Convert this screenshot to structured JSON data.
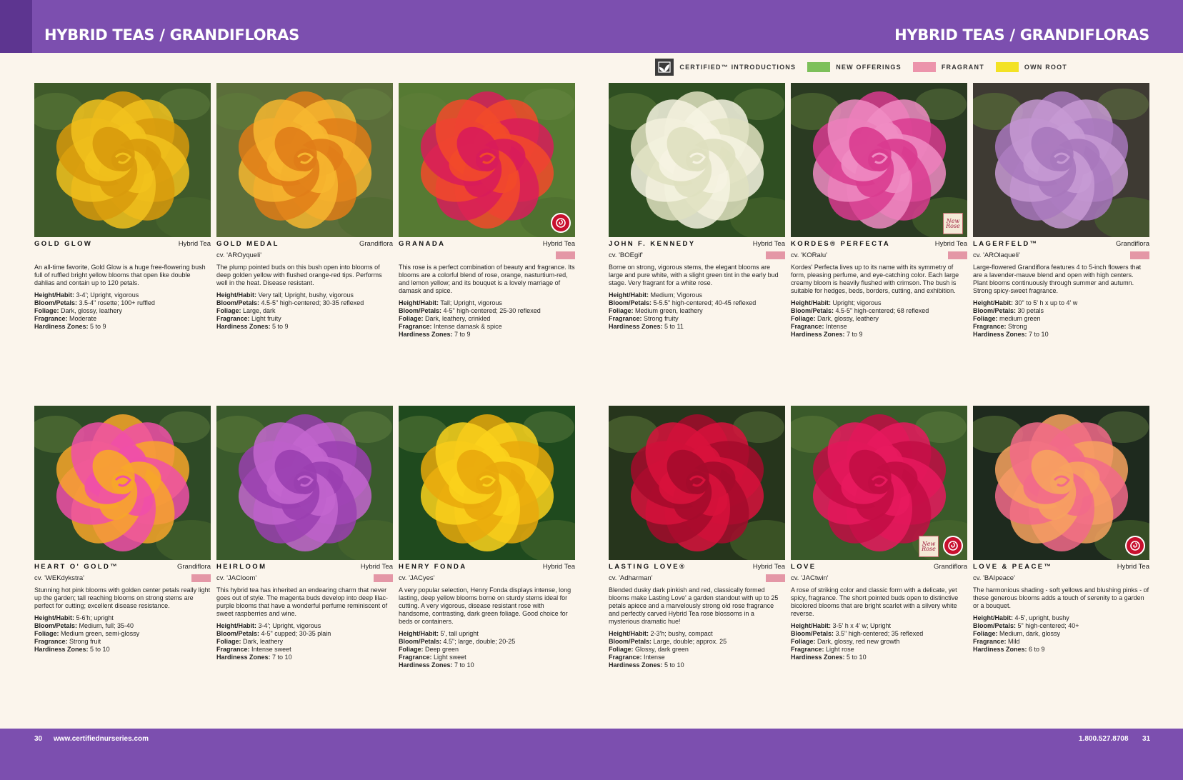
{
  "header": {
    "left_title": "HYBRID TEAS / GRANDIFLORAS",
    "right_title": "HYBRID TEAS / GRANDIFLORAS"
  },
  "legend": [
    {
      "label": "CERTIFIED™ INTRODUCTIONS",
      "icon": "certified-leaf-icon"
    },
    {
      "label": "NEW OFFERINGS",
      "color": "#7dc05a"
    },
    {
      "label": "FRAGRANT",
      "color": "#ec94ab"
    },
    {
      "label": "OWN ROOT",
      "color": "#f3e224"
    }
  ],
  "colors": {
    "brand_purple": "#7c4faf",
    "fragrant_pink": "#e497a6",
    "page_background": "#fbf5ec"
  },
  "roses": [
    {
      "name": "GOLD GLOW",
      "class": "Hybrid Tea",
      "cv": "",
      "fragrant": false,
      "badges": [],
      "photo_color": "#f2c21d",
      "photo_dark": "#d89a0c",
      "photo_bg": "#3f5a2a",
      "description": "An all-time favorite, Gold Glow is a huge free-flowering bush full of ruffled bright yellow blooms that open like double dahlias and contain up to 120 petals.",
      "specs": [
        {
          "label": "Height/Habit:",
          "value": "3-4'; Upright, vigorous"
        },
        {
          "label": "Bloom/Petals:",
          "value": "3.5-4\" rosette; 100+ ruffled"
        },
        {
          "label": "Foliage:",
          "value": "Dark, glossy, leathery"
        },
        {
          "label": "Fragrance:",
          "value": "Moderate"
        },
        {
          "label": "Hardiness Zones:",
          "value": "5 to 9"
        }
      ]
    },
    {
      "name": "GOLD MEDAL",
      "class": "Grandiflora",
      "cv": "cv. 'AROyqueli'",
      "fragrant": false,
      "badges": [],
      "photo_color": "#f7b730",
      "photo_dark": "#e07d18",
      "photo_bg": "#5b6e3a",
      "description": "The plump pointed buds on this bush open into blooms of deep golden yellow with flushed orange-red tips. Performs well in the heat. Disease resistant.",
      "specs": [
        {
          "label": "Height/Habit:",
          "value": "Very tall; Upright, bushy, vigorous"
        },
        {
          "label": "Bloom/Petals:",
          "value": "4.5-5\" high-centered; 30-35 reflexed"
        },
        {
          "label": "Foliage:",
          "value": "Large, dark"
        },
        {
          "label": "Fragrance:",
          "value": "Light fruity"
        },
        {
          "label": "Hardiness Zones:",
          "value": "5 to 9"
        }
      ]
    },
    {
      "name": "GRANADA",
      "class": "Hybrid Tea",
      "cv": "",
      "fragrant": true,
      "badges": [
        "rose"
      ],
      "photo_color": "#f24a2a",
      "photo_dark": "#d81c5a",
      "photo_bg": "#567a33",
      "description": "This rose is a perfect combination of beauty and fragrance. Its blooms are a colorful blend of rose, orange, nasturtium-red, and lemon yellow; and its bouquet is a lovely marriage of damask and spice.",
      "specs": [
        {
          "label": "Height/Habit:",
          "value": "Tall; Upright, vigorous"
        },
        {
          "label": "Bloom/Petals:",
          "value": "4-5\" high-centered; 25-30 reflexed"
        },
        {
          "label": "Foliage:",
          "value": "Dark, leathery, crinkled"
        },
        {
          "label": "Fragrance:",
          "value": "Intense damask & spice"
        },
        {
          "label": "Hardiness Zones:",
          "value": "7 to 9"
        }
      ]
    },
    {
      "name": "JOHN F. KENNEDY",
      "class": "Hybrid Tea",
      "cv": "cv. 'BOEgif'",
      "fragrant": true,
      "badges": [],
      "photo_color": "#f6f3e2",
      "photo_dark": "#dfe0c0",
      "photo_bg": "#2f4f22",
      "description": "Borne on strong, vigorous stems, the elegant blooms are large and pure white, with a slight green tint in the early bud stage. Very fragrant for a white rose.",
      "specs": [
        {
          "label": "Height/Habit:",
          "value": "Medium; Vigorous"
        },
        {
          "label": "Bloom/Petals:",
          "value": "5-5.5\" high-centered; 40-45 reflexed"
        },
        {
          "label": "Foliage:",
          "value": "Medium green, leathery"
        },
        {
          "label": "Fragrance:",
          "value": "Strong fruity"
        },
        {
          "label": "Hardiness Zones:",
          "value": "5 to 11"
        }
      ]
    },
    {
      "name": "KORDES® PERFECTA",
      "class": "Hybrid Tea",
      "cv": "cv. 'KORalu'",
      "fragrant": true,
      "badges": [
        "new"
      ],
      "photo_color": "#f08cc3",
      "photo_dark": "#d93b8f",
      "photo_bg": "#2a3a22",
      "description": "Kordes' Perfecta lives up to its name with its symmetry of form, pleasing perfume, and eye-catching color. Each large creamy bloom is heavily flushed with crimson. The bush is suitable for hedges, beds, borders, cutting, and exhibition.",
      "specs": [
        {
          "label": "Height/Habit:",
          "value": "Upright; vigorous"
        },
        {
          "label": "Bloom/Petals:",
          "value": "4.5-5\" high-centered; 68 reflexed"
        },
        {
          "label": "Foliage:",
          "value": "Dark, glossy, leathery"
        },
        {
          "label": "Fragrance:",
          "value": "Intense"
        },
        {
          "label": "Hardiness Zones:",
          "value": "7 to 9"
        }
      ]
    },
    {
      "name": "LAGERFELD™",
      "class": "Grandiflora",
      "cv": "cv. 'AROlaqueli'",
      "fragrant": true,
      "badges": [],
      "photo_color": "#c79ad4",
      "photo_dark": "#a878bd",
      "photo_bg": "#3e3a33",
      "description": "Large-flowered Grandiflora features 4 to 5-inch flowers that are a lavender-mauve blend and open with high centers. Plant blooms continuously through summer and autumn. Strong spicy-sweet fragrance.",
      "specs": [
        {
          "label": "Height/Habit:",
          "value": "30\" to 5' h x up to 4' w"
        },
        {
          "label": "Bloom/Petals:",
          "value": "30 petals"
        },
        {
          "label": "Foliage:",
          "value": "medium green"
        },
        {
          "label": "Fragrance:",
          "value": "Strong"
        },
        {
          "label": "Hardiness Zones:",
          "value": "7 to 10"
        }
      ]
    },
    {
      "name": "HEART O' GOLD™",
      "class": "Grandiflora",
      "cv": "cv. 'WEKdykstra'",
      "fragrant": true,
      "badges": [],
      "photo_color": "#f04fa8",
      "photo_dark": "#f7a62a",
      "photo_bg": "#2e4a26",
      "description": "Stunning hot pink blooms with golden center petals really light up the garden; tall reaching blooms on strong stems are perfect for cutting; excellent disease resistance.",
      "specs": [
        {
          "label": "Height/Habit:",
          "value": "5-6'h; upright"
        },
        {
          "label": "Bloom/Petals:",
          "value": "Medium, full; 35-40"
        },
        {
          "label": "Foliage:",
          "value": "Medium green, semi-glossy"
        },
        {
          "label": "Fragrance:",
          "value": "Strong fruit"
        },
        {
          "label": "Hardiness Zones:",
          "value": "5 to 10"
        }
      ]
    },
    {
      "name": "HEIRLOOM",
      "class": "Hybrid Tea",
      "cv": "cv. 'JACloom'",
      "fragrant": true,
      "badges": [],
      "photo_color": "#c366cf",
      "photo_dark": "#9a3fb0",
      "photo_bg": "#3a5a2c",
      "description": "This hybrid tea has inherited an endearing charm that never goes out of style. The magenta buds develop into deep lilac-purple blooms that have a wonderful perfume reminiscent of sweet raspberries and wine.",
      "specs": [
        {
          "label": "Height/Habit:",
          "value": "3-4'; Upright, vigorous"
        },
        {
          "label": "Bloom/Petals:",
          "value": "4-5\" cupped; 30-35 plain"
        },
        {
          "label": "Foliage:",
          "value": "Dark, leathery"
        },
        {
          "label": "Fragrance:",
          "value": "Intense sweet"
        },
        {
          "label": "Hardiness Zones:",
          "value": "7 to 10"
        }
      ]
    },
    {
      "name": "HENRY FONDA",
      "class": "Hybrid Tea",
      "cv": "cv. 'JACyes'",
      "fragrant": false,
      "badges": [],
      "photo_color": "#fbd21c",
      "photo_dark": "#e9a90c",
      "photo_bg": "#1f4a1e",
      "description": "A very popular selection, Henry Fonda displays intense, long lasting, deep yellow blooms borne on sturdy stems ideal for cutting. A very vigorous, disease resistant rose with handsome, contrasting, dark green foliage. Good choice for beds or containers.",
      "specs": [
        {
          "label": "Height/Habit:",
          "value": "5', tall upright"
        },
        {
          "label": "Bloom/Petals:",
          "value": "4.5\"; large, double; 20-25"
        },
        {
          "label": "Foliage:",
          "value": "Deep green"
        },
        {
          "label": "Fragrance:",
          "value": "Light sweet"
        },
        {
          "label": "Hardiness Zones:",
          "value": "7 to 10"
        }
      ]
    },
    {
      "name": "LASTING LOVE®",
      "class": "Hybrid Tea",
      "cv": "cv. 'Adharman'",
      "fragrant": true,
      "badges": [],
      "photo_color": "#d8123c",
      "photo_dark": "#a50b2c",
      "photo_bg": "#26351c",
      "description": "Blended dusky dark pinkish and red, classically formed blooms make Lasting Love' a garden standout with up to 25 petals apiece and a marvelously strong old rose fragrance and perfectly carved Hybrid Tea rose blossoms in a mysterious dramatic hue!",
      "specs": [
        {
          "label": "Height/Habit:",
          "value": "2-3'h; bushy, compact"
        },
        {
          "label": "Bloom/Petals:",
          "value": "Large, double; approx. 25"
        },
        {
          "label": "Foliage:",
          "value": "Glossy, dark green"
        },
        {
          "label": "Fragrance:",
          "value": "Intense"
        },
        {
          "label": "Hardiness Zones:",
          "value": "5 to 10"
        }
      ]
    },
    {
      "name": "LOVE",
      "class": "Grandiflora",
      "cv": "cv. 'JACtwin'",
      "fragrant": false,
      "badges": [
        "new",
        "rose"
      ],
      "photo_color": "#e8195e",
      "photo_dark": "#c20d44",
      "photo_bg": "#3a5a2a",
      "description": "A rose of striking color and classic form with a delicate, yet spicy, fragrance. The short pointed buds open to distinctive bicolored blooms that are bright scarlet with a silvery white reverse.",
      "specs": [
        {
          "label": "Height/Habit:",
          "value": "3-5' h x 4' w; Upright"
        },
        {
          "label": "Bloom/Petals:",
          "value": "3.5\" high-centered; 35 reflexed"
        },
        {
          "label": "Foliage:",
          "value": "Dark, glossy,  red new growth"
        },
        {
          "label": "Fragrance:",
          "value": "Light rose"
        },
        {
          "label": "Hardiness Zones:",
          "value": "5 to 10"
        }
      ]
    },
    {
      "name": "LOVE & PEACE™",
      "class": "Hybrid Tea",
      "cv": "cv. 'BAIpeace'",
      "fragrant": false,
      "badges": [
        "rose"
      ],
      "photo_color": "#f26a8a",
      "photo_dark": "#f7a25f",
      "photo_bg": "#1e2a1e",
      "description": "The harmonious shading - soft yellows and blushing pinks - of these generous blooms adds a touch of serenity to a garden or a bouquet.",
      "specs": [
        {
          "label": "Height/Habit:",
          "value": "4-5', upright, bushy"
        },
        {
          "label": "Bloom/Petals:",
          "value": "5\" high-centered; 40+"
        },
        {
          "label": "Foliage:",
          "value": "Medium, dark, glossy"
        },
        {
          "label": "Fragrance:",
          "value": "Mild"
        },
        {
          "label": "Hardiness Zones:",
          "value": "6 to 9"
        }
      ]
    }
  ],
  "badge_text": {
    "new": "New Rose"
  },
  "footer": {
    "left_page": "30",
    "website": "www.certifiednurseries.com",
    "phone": "1.800.527.8708",
    "right_page": "31"
  }
}
